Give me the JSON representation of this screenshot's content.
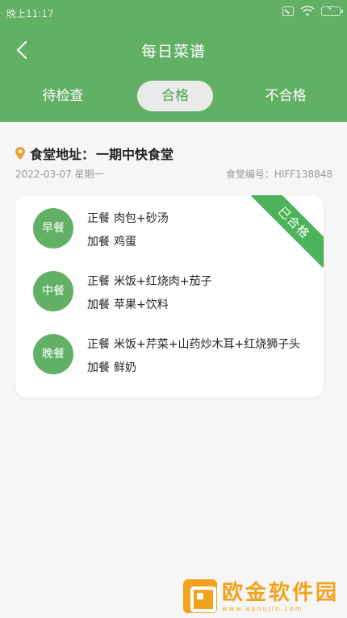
{
  "status_bar": {
    "time": "晚上11:17",
    "icons": [
      "sim-icon",
      "wifi-icon",
      "battery-charging-icon"
    ]
  },
  "nav": {
    "title": "每日菜谱",
    "back_icon": "back-icon"
  },
  "tabs": [
    {
      "label": "待检查",
      "active": false
    },
    {
      "label": "合格",
      "active": true
    },
    {
      "label": "不合格",
      "active": false
    }
  ],
  "info": {
    "address_label": "食堂地址：",
    "address_value": "一期中快食堂",
    "date": "2022-03-07 星期一",
    "canteen_no": "食堂编号：HIFF138848"
  },
  "card": {
    "status_ribbon": "已合格",
    "meals": [
      {
        "name": "早餐",
        "main_label": "正餐",
        "main_items": "肉包+砂汤",
        "extra_label": "加餐",
        "extra_items": "鸡蛋"
      },
      {
        "name": "中餐",
        "main_label": "正餐",
        "main_items": "米饭+红烧肉+茄子",
        "extra_label": "加餐",
        "extra_items": "苹果+饮料"
      },
      {
        "name": "晚餐",
        "main_label": "正餐",
        "main_items": "米饭+芹菜+山药炒木耳+红烧狮子头",
        "extra_label": "加餐",
        "extra_items": "鲜奶"
      }
    ]
  },
  "watermark": {
    "text": "欧金软件园",
    "url": "www.apoujin.com"
  },
  "colors": {
    "primary": "#62b066",
    "ribbon": "#4cb35a",
    "watermark": "#f3a21d"
  }
}
